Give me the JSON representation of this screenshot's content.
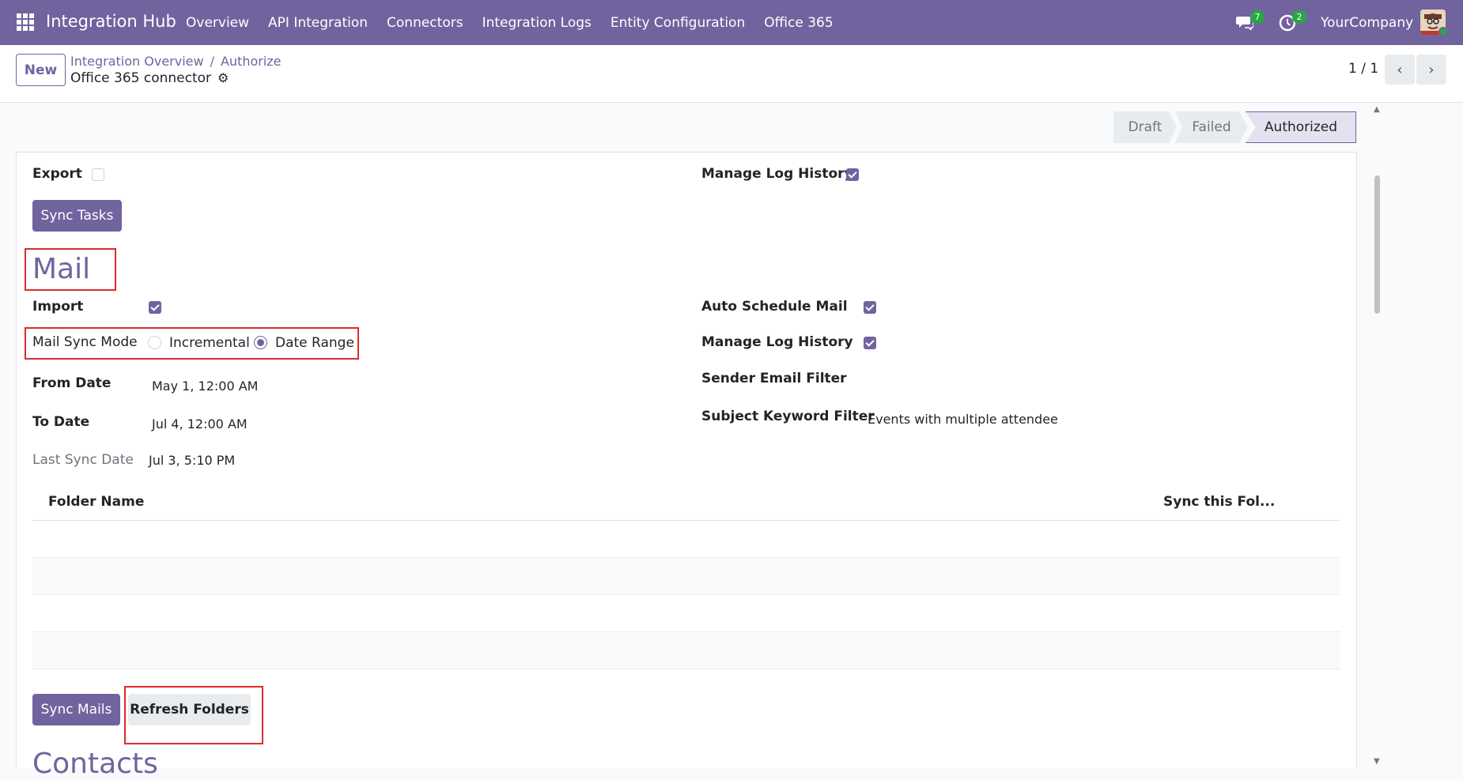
{
  "navbar": {
    "brand": "Integration Hub",
    "menu": [
      "Overview",
      "API Integration",
      "Connectors",
      "Integration Logs",
      "Entity Configuration",
      "Office 365"
    ],
    "messages_count": "7",
    "activities_count": "2",
    "company": "YourCompany"
  },
  "control": {
    "new_label": "New",
    "breadcrumb": [
      "Integration Overview",
      "Authorize"
    ],
    "record_title": "Office 365 connector",
    "pager": "1 / 1"
  },
  "statusbar": {
    "stages": [
      "Draft",
      "Failed",
      "Authorized"
    ],
    "active": "Authorized"
  },
  "tasks": {
    "export_label": "Export",
    "export_checked": false,
    "manage_log_label": "Manage Log History",
    "manage_log_checked": true,
    "sync_button": "Sync Tasks"
  },
  "mail": {
    "title": "Mail",
    "import_label": "Import",
    "import_checked": true,
    "sync_mode_label": "Mail Sync Mode",
    "sync_mode_options": [
      "Incremental",
      "Date Range"
    ],
    "sync_mode_selected": "Date Range",
    "from_date_label": "From Date",
    "from_date": "May 1, 12:00 AM",
    "to_date_label": "To Date",
    "to_date": "Jul 4, 12:00 AM",
    "last_sync_label": "Last Sync Date",
    "last_sync": "Jul 3, 5:10 PM",
    "auto_schedule_label": "Auto Schedule Mail",
    "auto_schedule_checked": true,
    "manage_log_label": "Manage Log History",
    "manage_log_checked": true,
    "sender_filter_label": "Sender Email Filter",
    "subject_filter_label": "Subject Keyword Filter",
    "subject_filter": "Events with multiple attendee",
    "table_headers": [
      "Folder Name",
      "Sync this Fol..."
    ],
    "sync_button": "Sync Mails",
    "refresh_button": "Refresh Folders"
  },
  "contacts": {
    "title": "Contacts"
  },
  "colors": {
    "brand": "#71639e",
    "annotation": "#e02b2b"
  }
}
